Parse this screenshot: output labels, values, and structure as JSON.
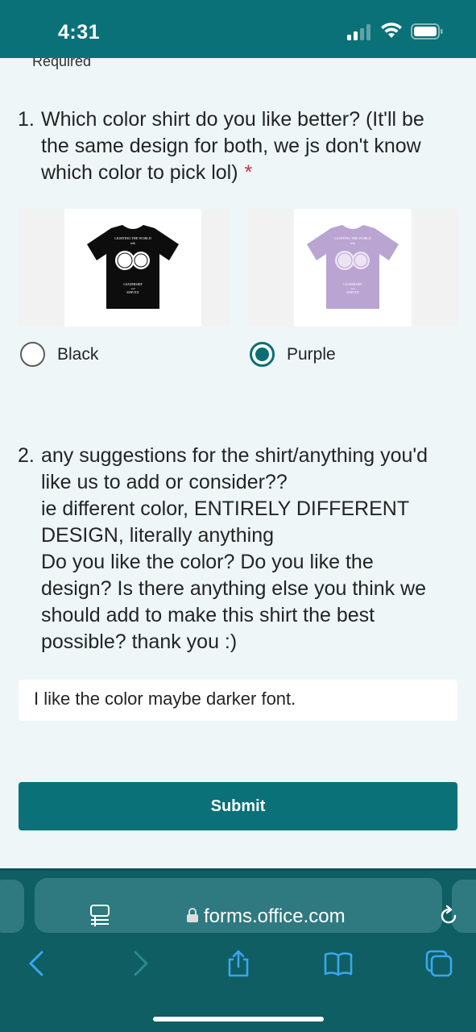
{
  "status_bar": {
    "time": "4:31"
  },
  "form": {
    "required_note": "Required",
    "required_marker": "*",
    "q1": {
      "number": "1.",
      "lines": [
        "Which color shirt do you like better? (It'll be",
        "the same design for both, we js don't know",
        "which color to pick lol)"
      ],
      "required_marker": "*",
      "shirt_black_text": [
        "LIGHTING THE WORLD",
        "with",
        "LEADERSHIP",
        "and",
        "SERVICE"
      ],
      "shirt_purple_text": [
        "LIGHTING THE WORLD",
        "with",
        "LEADERSHIP",
        "and",
        "SERVICE"
      ],
      "options": [
        {
          "label": "Black",
          "selected": false
        },
        {
          "label": "Purple",
          "selected": true
        }
      ]
    },
    "q2": {
      "number": "2.",
      "lines": [
        "any suggestions for the shirt/anything you'd",
        "like us to add or consider??",
        "ie different color, ENTIRELY DIFFERENT",
        "DESIGN, literally anything",
        "Do you like the color? Do you like the",
        "design? Is there anything else you think we",
        "should add to make this shirt the best",
        "possible? thank you :)"
      ],
      "answer": "I like the color maybe darker font."
    },
    "submit_label": "Submit"
  },
  "browser": {
    "url": "forms.office.com"
  },
  "colors": {
    "accent": "#0a7178",
    "required": "#c4314b",
    "background": "#eef6f7",
    "purple_shirt": "#b9a4d2"
  },
  "icons": [
    "signal-icon",
    "wifi-icon",
    "battery-icon",
    "reader-mode-icon",
    "lock-icon",
    "reload-icon",
    "back-icon",
    "forward-icon",
    "share-icon",
    "bookmarks-icon",
    "tabs-icon"
  ]
}
